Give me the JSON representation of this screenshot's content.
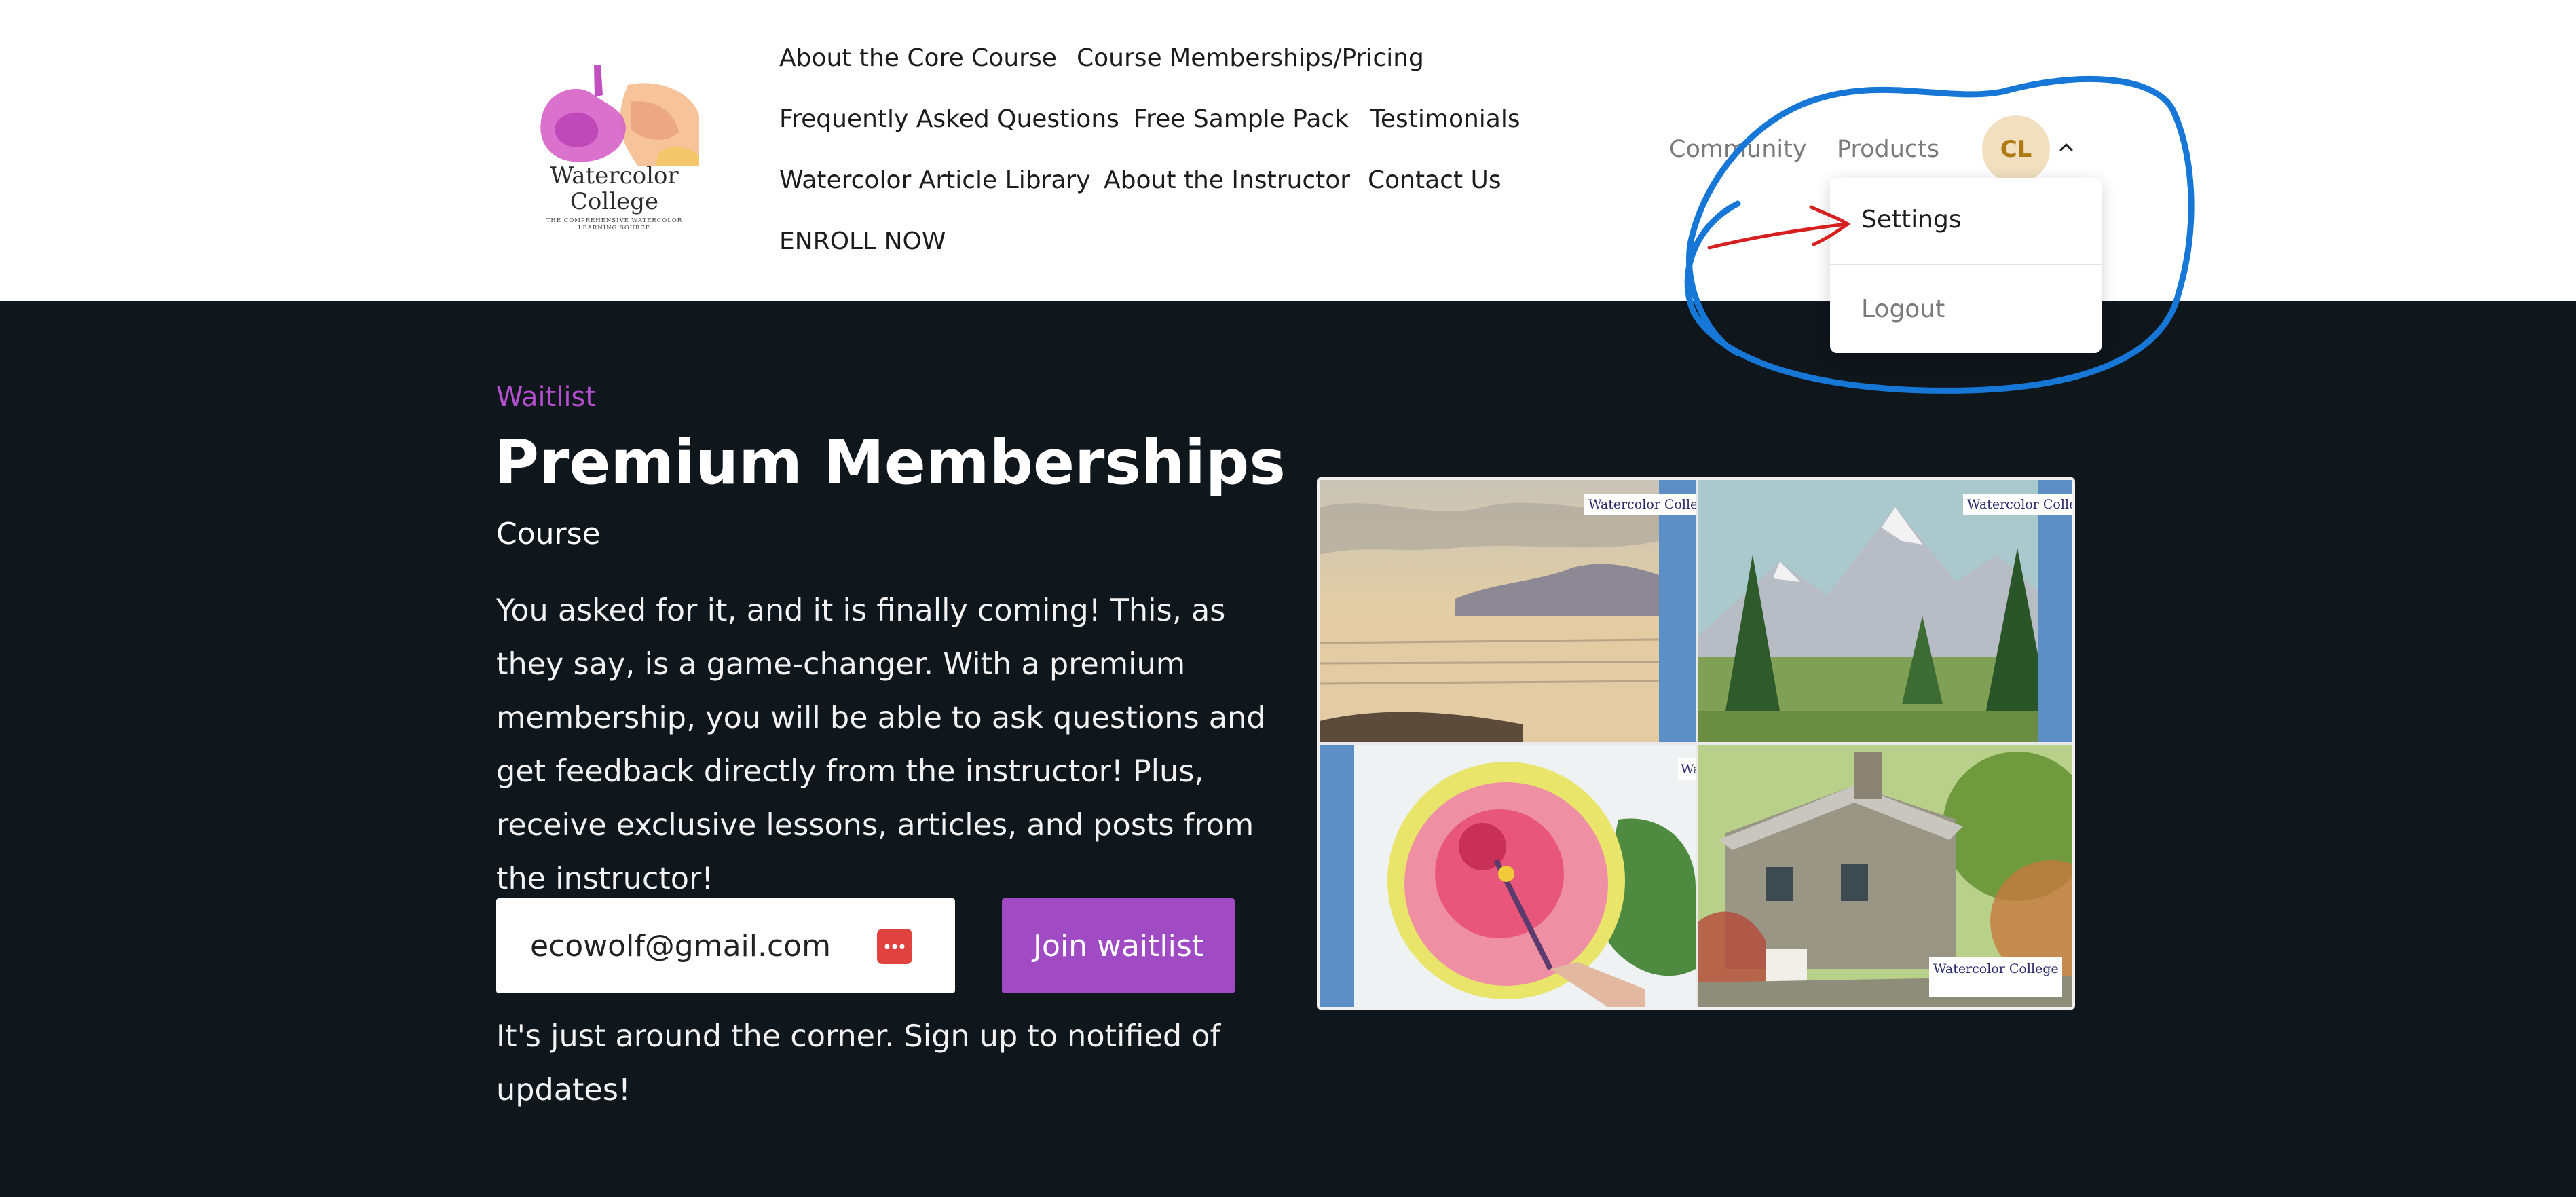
{
  "logo": {
    "name_line1": "Watercolor",
    "name_line2": "College",
    "tagline": "THE COMPREHENSIVE WATERCOLOR LEARNING SOURCE"
  },
  "nav": {
    "links": [
      "About the Core Course",
      "Course Memberships/Pricing",
      "Frequently Asked Questions",
      "Free Sample Pack",
      "Testimonials",
      "Watercolor Article Library",
      "About the Instructor",
      "Contact Us",
      "ENROLL NOW"
    ],
    "community": "Community",
    "products": "Products",
    "avatar_initials": "CL"
  },
  "user_menu": {
    "settings": "Settings",
    "logout": "Logout"
  },
  "hero": {
    "eyebrow": "Waitlist",
    "title": "Premium Memberships",
    "subtitle": "Course",
    "description": "You asked for it, and it is finally coming!  This, as they say, is a game-changer. With a premium membership, you will be able to ask questions and get feedback directly from the instructor! Plus, receive exclusive lessons, articles, and posts from the instructor!",
    "email_value": "ecowolf@gmail.com",
    "join_label": "Join waitlist",
    "note": "It's just around the corner. Sign up to notified of updates!"
  },
  "gallery": {
    "watermark": "Watercolor College",
    "watermark_partial": "Wa"
  },
  "colors": {
    "accent_purple": "#a04bc3",
    "eyebrow_purple": "#b54fd0",
    "background_dark": "#0f161c",
    "avatar_bg": "#f1dfc0",
    "annotation_blue": "#1677d6",
    "annotation_red": "#d62020"
  },
  "icons": [
    "chevron-up-icon",
    "password-manager-icon"
  ]
}
